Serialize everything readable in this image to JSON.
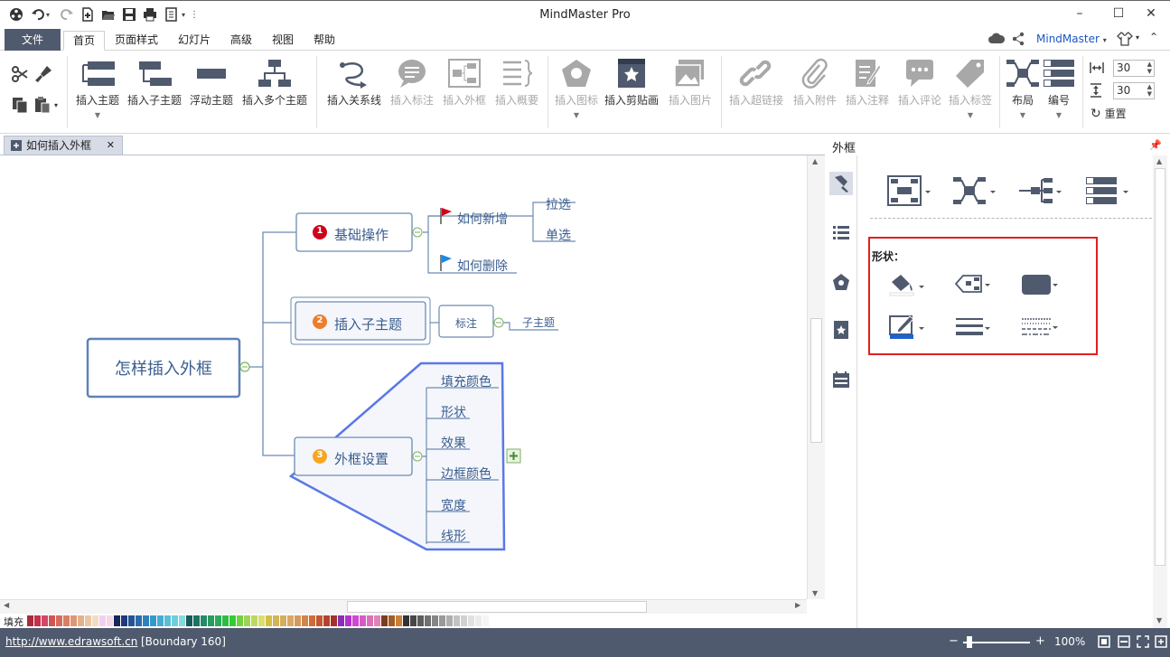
{
  "window": {
    "title": "MindMaster Pro",
    "minimize": "–",
    "maximize": "☐",
    "close": "✕"
  },
  "menu": {
    "file": "文件",
    "tabs": [
      "首页",
      "页面样式",
      "幻灯片",
      "高级",
      "视图",
      "帮助"
    ],
    "account": "MindMaster"
  },
  "ribbon": {
    "insert_topic": "插入主题",
    "insert_subtopic": "插入子主题",
    "floating_topic": "浮动主题",
    "insert_multi": "插入多个主题",
    "relation": "插入关系线",
    "callout": "插入标注",
    "boundary": "插入外框",
    "summary": "插入概要",
    "icon": "插入图标",
    "clipart": "插入剪贴画",
    "picture": "插入图片",
    "hyperlink": "插入超链接",
    "attachment": "插入附件",
    "note": "插入注释",
    "comment": "插入评论",
    "tag": "插入标签",
    "layout": "布局",
    "numbering": "编号",
    "spacing_h": "30",
    "spacing_v": "30",
    "reset": "重置"
  },
  "doc_tab": {
    "title": "如何插入外框",
    "close": "✕"
  },
  "mindmap": {
    "root": "怎样插入外框",
    "topics": [
      {
        "num": "1",
        "label": "基础操作",
        "color": "#d0021b"
      },
      {
        "num": "2",
        "label": "插入子主题",
        "color": "#ef7d2a"
      },
      {
        "num": "3",
        "label": "外框设置",
        "color": "#f5a623"
      }
    ],
    "t1_children": [
      "如何新增",
      "如何删除"
    ],
    "t1_grand": [
      "拉选",
      "单选"
    ],
    "t2_callout": "标注",
    "t2_child": "子主题",
    "t3_children": [
      "填充颜色",
      "形状",
      "效果",
      "边框颜色",
      "宽度",
      "线形"
    ],
    "expand": "+"
  },
  "panel": {
    "title": "外框",
    "shape_label": "形状："
  },
  "palette": {
    "label": "填充"
  },
  "status": {
    "url": "http://www.edrawsoft.cn",
    "info": "[Boundary 160]",
    "zoom": "100%",
    "zoom_minus": "−",
    "zoom_plus": "+"
  },
  "colors": {
    "status_bg": "#505a6e",
    "accent": "#5b78e6",
    "topic_border": "#6d8bb2",
    "highlight": "#e02020"
  }
}
